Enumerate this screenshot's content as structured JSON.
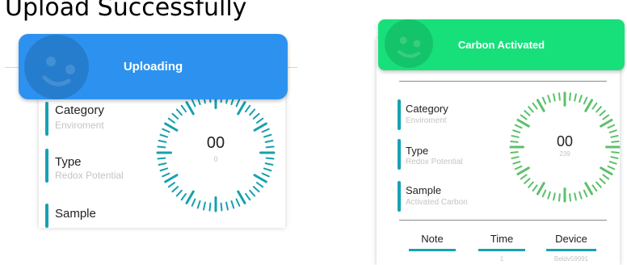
{
  "heading": "Upload Successfully",
  "left": {
    "toast": {
      "text": "Uploading",
      "color": "#2d92ef"
    },
    "fields": [
      {
        "label": "Category",
        "value": "Enviroment"
      },
      {
        "label": "Type",
        "value": "Redox Potential"
      },
      {
        "label": "Sample"
      }
    ],
    "dial": {
      "reading": "00",
      "sub": "0",
      "color": "#17a0ad",
      "progress": 0
    }
  },
  "right": {
    "toast": {
      "text": "Carbon Activated",
      "color": "#17e07a"
    },
    "fields": [
      {
        "label": "Category",
        "value": "Enviroment"
      },
      {
        "label": "Type",
        "value": "Redox Potential"
      },
      {
        "label": "Sample",
        "value": "Activated Carbon"
      }
    ],
    "dial": {
      "reading": "00",
      "sub": "239",
      "color": "#5cc06a"
    },
    "table": {
      "headers": [
        "Note",
        "Time",
        "Device"
      ],
      "values": [
        "",
        "1",
        "Beldv59991"
      ]
    }
  },
  "icons": [
    "smiley-face-icon"
  ]
}
